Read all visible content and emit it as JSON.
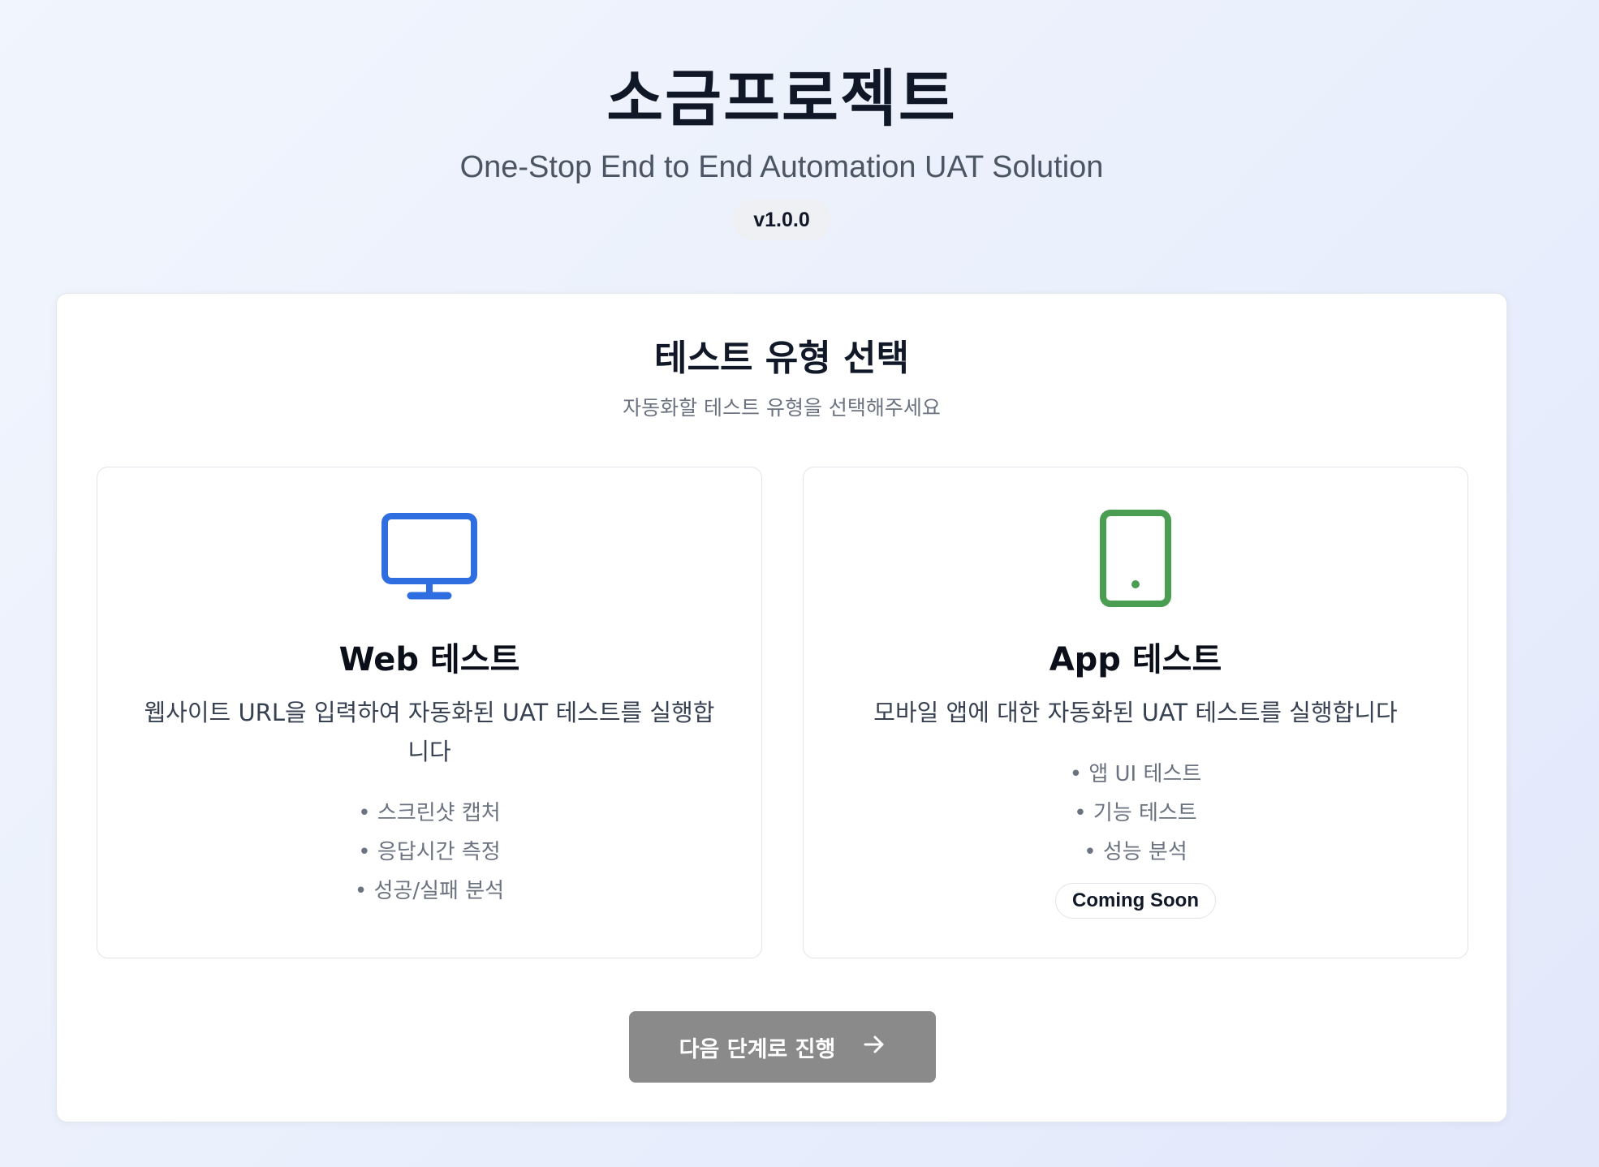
{
  "header": {
    "title": "소금프로젝트",
    "subtitle": "One-Stop End to End Automation UAT Solution",
    "version": "v1.0.0"
  },
  "panel": {
    "title": "테스트 유형 선택",
    "subtitle": "자동화할 테스트 유형을 선택해주세요"
  },
  "cards": [
    {
      "icon": "monitor-icon",
      "icon_color": "#2f6ee0",
      "title": "Web 테스트",
      "description": "웹사이트 URL을 입력하여 자동화된 UAT 테스트를 실행합니다",
      "features": [
        "• 스크린샷 캡처",
        "• 응답시간 측정",
        "• 성공/실패 분석"
      ]
    },
    {
      "icon": "mobile-icon",
      "icon_color": "#4a9e52",
      "title": "App 테스트",
      "description": "모바일 앱에 대한 자동화된 UAT 테스트를 실행합니다",
      "features": [
        "• 앱 UI 테스트",
        "• 기능 테스트",
        "• 성능 분석"
      ],
      "badge": "Coming Soon"
    }
  ],
  "next_button": {
    "label": "다음 단계로 진행",
    "icon": "arrow-right-icon"
  }
}
